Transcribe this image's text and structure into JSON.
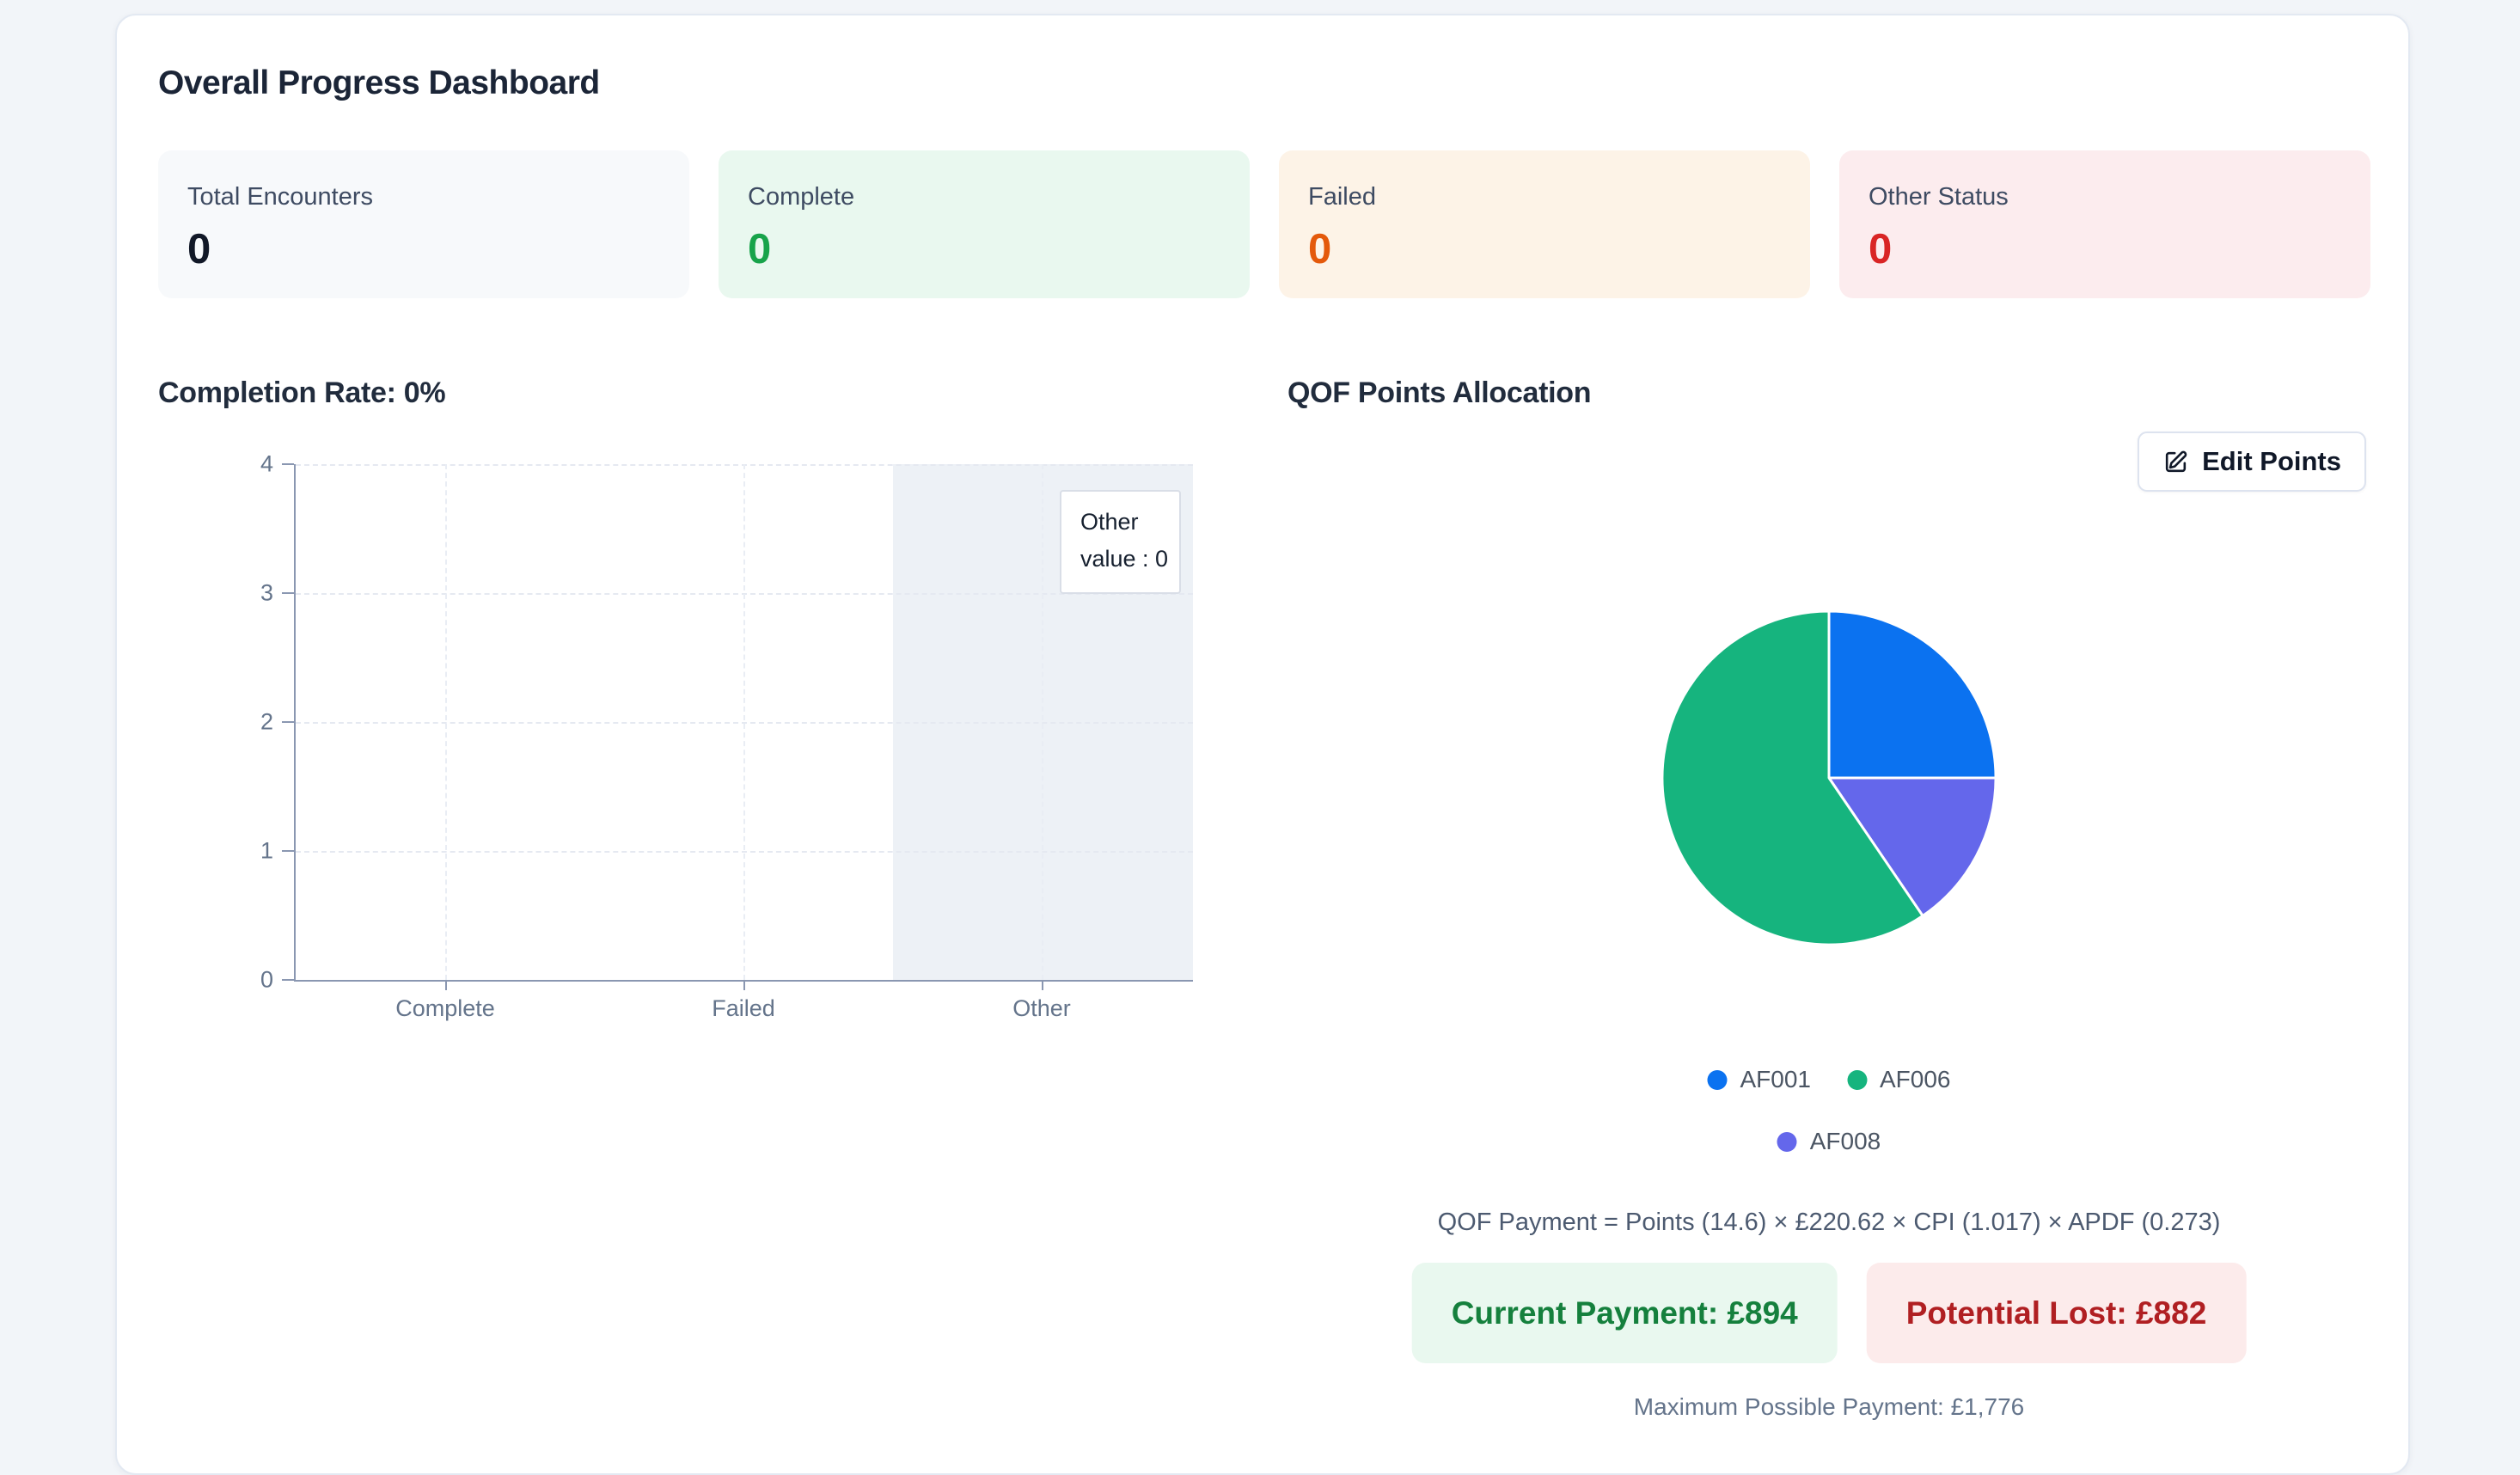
{
  "page": {
    "title": "Overall Progress Dashboard"
  },
  "stats": [
    {
      "label": "Total Encounters",
      "value": "0",
      "bg": "#f7f9fb",
      "value_color": "#111827"
    },
    {
      "label": "Complete",
      "value": "0",
      "bg": "#e9f8ef",
      "value_color": "#17a34a"
    },
    {
      "label": "Failed",
      "value": "0",
      "bg": "#fdf3e7",
      "value_color": "#e4590b"
    },
    {
      "label": "Other Status",
      "value": "0",
      "bg": "#fcecee",
      "value_color": "#d92525"
    }
  ],
  "completion_section": {
    "title": "Completion Rate: 0%"
  },
  "qof_section": {
    "title": "QOF Points Allocation",
    "edit_button_label": "Edit Points",
    "formula": "QOF Payment = Points (14.6) × £220.62 × CPI (1.017) × APDF (0.273)",
    "current_payment": "Current Payment: £894",
    "potential_lost": "Potential Lost: £882",
    "max_payment": "Maximum Possible Payment: £1,776"
  },
  "chart_data": [
    {
      "type": "bar",
      "title": "Completion Rate: 0%",
      "categories": [
        "Complete",
        "Failed",
        "Other"
      ],
      "values": [
        0,
        0,
        0
      ],
      "ylim": [
        0,
        4
      ],
      "yticks": [
        4,
        3,
        2,
        1,
        0
      ],
      "grid": "dashed",
      "legend_position": "none",
      "highlighted_category": "Other",
      "tooltip": {
        "title": "Other",
        "line": "value : 0"
      },
      "bar_color": "#0b72f0",
      "band_color": "#edf1f6"
    },
    {
      "type": "pie",
      "title": "QOF Points Allocation",
      "legend_position": "bottom",
      "series": [
        {
          "name": "AF001",
          "percent": 25,
          "color": "#0b72f0"
        },
        {
          "name": "AF006",
          "percent": 59.5,
          "color": "#16b47e"
        },
        {
          "name": "AF008",
          "percent": 15.5,
          "color": "#6467eb"
        }
      ],
      "draw_order_clockwise_from_top": [
        0,
        2,
        1
      ]
    }
  ]
}
